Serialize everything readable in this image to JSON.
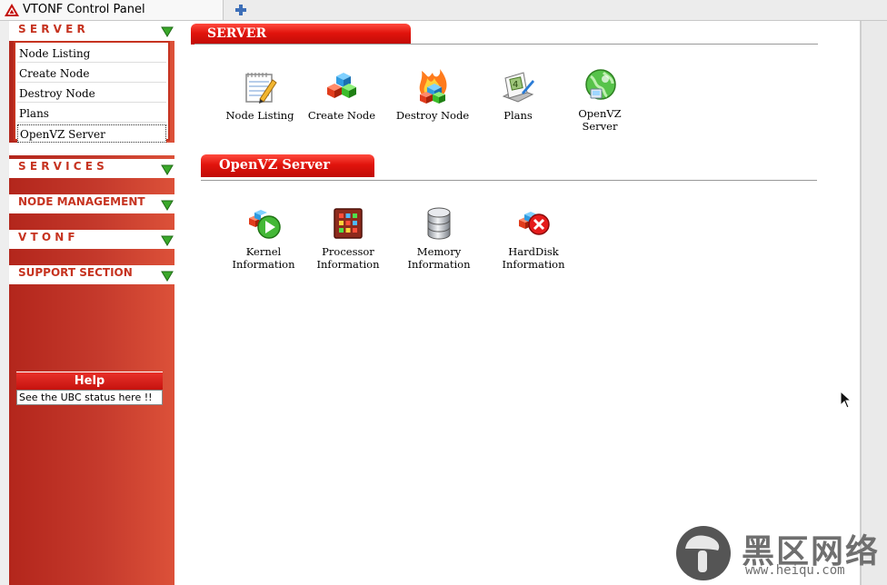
{
  "browser": {
    "tab_title": "VTONF Control Panel"
  },
  "sidebar": {
    "sections": [
      {
        "title": "S E R V E R"
      },
      {
        "title": "S E R V I C E S"
      },
      {
        "title": "NODE MANAGEMENT"
      },
      {
        "title": "V T O N F"
      },
      {
        "title": "SUPPORT SECTION"
      }
    ],
    "server_items": [
      {
        "label": "Node Listing"
      },
      {
        "label": "Create Node"
      },
      {
        "label": "Destroy Node"
      },
      {
        "label": "Plans"
      },
      {
        "label": "OpenVZ Server"
      }
    ],
    "help": {
      "title": "Help",
      "text": "See the UBC status here !!"
    }
  },
  "main": {
    "server_section": {
      "title": "SERVER",
      "icons": [
        {
          "label": "Node Listing",
          "icon": "notepad-pencil-icon"
        },
        {
          "label": "Create Node",
          "icon": "cubes-icon"
        },
        {
          "label": "Destroy Node",
          "icon": "burning-cubes-icon"
        },
        {
          "label": "Plans",
          "icon": "plans-icon"
        },
        {
          "label": "OpenVZ Server",
          "icon": "globe-icon"
        }
      ]
    },
    "openvz_section": {
      "title": "OpenVZ Server",
      "icons": [
        {
          "label": "Kernel Information",
          "icon": "kernel-play-icon"
        },
        {
          "label": "Processor Information",
          "icon": "processor-icon"
        },
        {
          "label": "Memory Information",
          "icon": "database-icon"
        },
        {
          "label": "HardDisk Information",
          "icon": "harddisk-error-icon"
        }
      ]
    }
  },
  "watermark": {
    "text_cn": "黑区网络",
    "url": "www.heiqu.com"
  },
  "colors": {
    "sidebar_red": "#c63320",
    "section_red": "#e1140d",
    "arrow_green": "#3aa82a"
  }
}
